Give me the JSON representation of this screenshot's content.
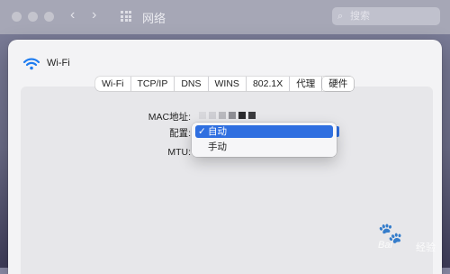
{
  "window": {
    "title": "网络",
    "search_placeholder": "搜索"
  },
  "sheet": {
    "title": "Wi-Fi",
    "tabs": [
      {
        "label": "Wi-Fi",
        "active": false
      },
      {
        "label": "TCP/IP",
        "active": false
      },
      {
        "label": "DNS",
        "active": false
      },
      {
        "label": "WINS",
        "active": false
      },
      {
        "label": "802.1X",
        "active": false
      },
      {
        "label": "代理",
        "active": false
      },
      {
        "label": "硬件",
        "active": true
      }
    ],
    "fields": {
      "mac_label": "MAC地址:",
      "config_label": "配置:",
      "mtu_label": "MTU:"
    }
  },
  "config_menu": {
    "options": [
      {
        "label": "自动",
        "selected": true,
        "check": "✓"
      },
      {
        "label": "手动",
        "selected": false
      }
    ]
  },
  "watermark": {
    "brand": "Bai",
    "sub": "经验"
  },
  "colors": {
    "accent": "#2f6fe0"
  }
}
